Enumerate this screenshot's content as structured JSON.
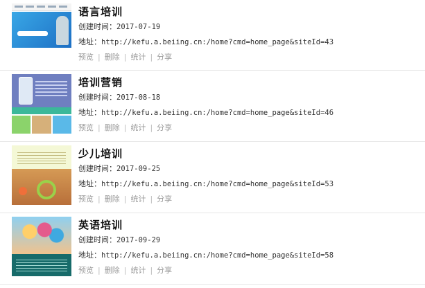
{
  "sites": [
    {
      "title": "语言培训",
      "created_label": "创建时间：",
      "created": "2017-07-19",
      "url_label": "地址：",
      "url": "http://kefu.a.beiing.cn:/home?cmd=home_page&siteId=43"
    },
    {
      "title": "培训营销",
      "created_label": "创建时间：",
      "created": "2017-08-18",
      "url_label": "地址：",
      "url": "http://kefu.a.beiing.cn:/home?cmd=home_page&siteId=46"
    },
    {
      "title": "少儿培训",
      "created_label": "创建时间：",
      "created": "2017-09-25",
      "url_label": "地址：",
      "url": "http://kefu.a.beiing.cn:/home?cmd=home_page&siteId=53"
    },
    {
      "title": "英语培训",
      "created_label": "创建时间：",
      "created": "2017-09-29",
      "url_label": "地址：",
      "url": "http://kefu.a.beiing.cn:/home?cmd=home_page&siteId=58"
    }
  ],
  "actions": {
    "preview": "预览",
    "delete": "删除",
    "stats": "统计",
    "share": "分享",
    "separator": "|"
  },
  "colors": {
    "tile_green": "#8bd36b",
    "tile_tan": "#d6b07a",
    "tile_blue": "#5ab9e8"
  }
}
